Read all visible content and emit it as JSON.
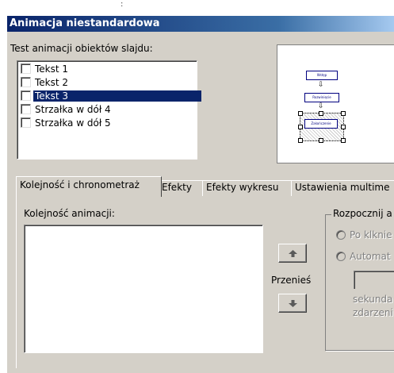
{
  "window": {
    "title": "Animacja niestandardowa",
    "top_mark": ":"
  },
  "objects": {
    "label": "Test animacji obiektów slajdu:",
    "items": [
      {
        "label": "Tekst 1",
        "checked": false,
        "selected": false
      },
      {
        "label": "Tekst 2",
        "checked": false,
        "selected": false
      },
      {
        "label": "Tekst 3",
        "checked": false,
        "selected": true
      },
      {
        "label": "Strzałka w dół 4",
        "checked": false,
        "selected": false
      },
      {
        "label": "Strzałka w dół 5",
        "checked": false,
        "selected": false
      }
    ]
  },
  "preview": {
    "boxes": [
      "Wstęp",
      "Rozwinięcie",
      "Zakończenie"
    ],
    "arrow_glyph": "⇩"
  },
  "tabs": [
    {
      "label": "Kolejność i chronometraż",
      "active": true
    },
    {
      "label": "Efekty",
      "active": false
    },
    {
      "label": "Efekty wykresu",
      "active": false
    },
    {
      "label": "Ustawienia multime",
      "active": false
    }
  ],
  "order": {
    "label": "Kolejność animacji:",
    "move_label": "Przenieś",
    "up_icon": "arrow-up-icon",
    "down_icon": "arrow-down-icon"
  },
  "start": {
    "label": "Rozpocznij a",
    "option_click": "Po klknie",
    "option_auto": "Automat",
    "seconds_text": "sekunda",
    "event_text": "zdarzeni"
  },
  "colors": {
    "titlebar": "#0a246a",
    "selection": "#0a246a",
    "dialog_bg": "#d4d0c8"
  }
}
